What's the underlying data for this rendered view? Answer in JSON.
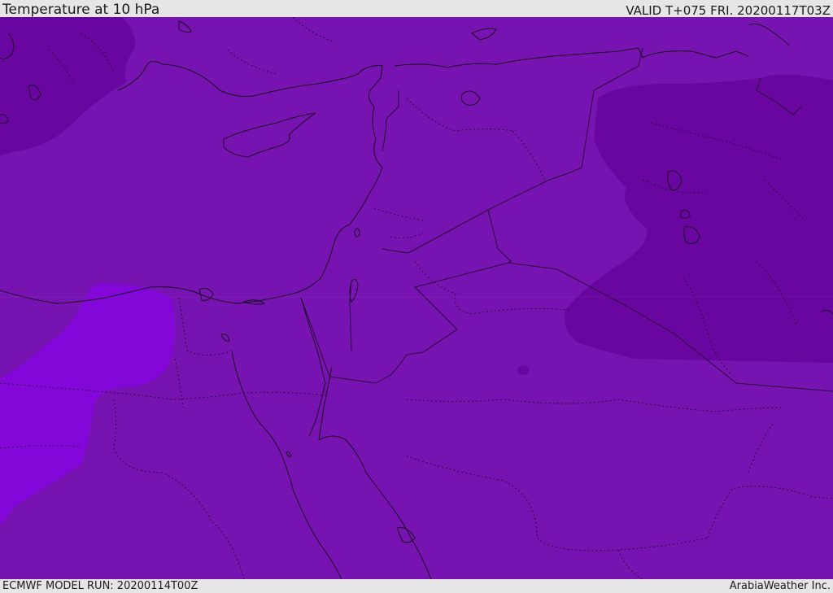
{
  "header": {
    "title": "Temperature at 10 hPa",
    "valid_time": "VALID T+075 FRI. 20200117T03Z"
  },
  "footer": {
    "model_run": "ECMWF MODEL RUN: 20200114T00Z",
    "credit": "ArabiaWeather Inc."
  },
  "map": {
    "colors": {
      "base_fill": "#7713b0",
      "cold_fill": "#68069f",
      "warm_fill": "#8307d9",
      "coastline": "#1a0a24",
      "border": "#2a0a3a"
    }
  }
}
